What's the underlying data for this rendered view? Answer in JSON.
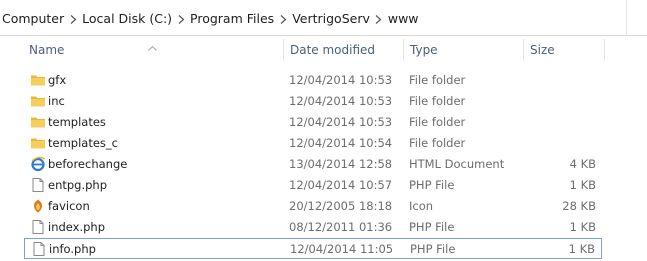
{
  "breadcrumb": [
    "Computer",
    "Local Disk (C:)",
    "Program Files",
    "VertrigoServ",
    "www"
  ],
  "columns": {
    "name": "Name",
    "date": "Date modified",
    "type": "Type",
    "size": "Size"
  },
  "colors": {
    "header_text": "#4c607a",
    "folder_yellow": "#f0c64a",
    "focus_border": "#7da2ce"
  },
  "rows": [
    {
      "icon": "folder-icon",
      "name": "gfx",
      "date": "12/04/2014 10:53",
      "type": "File folder",
      "size": ""
    },
    {
      "icon": "folder-icon",
      "name": "inc",
      "date": "12/04/2014 10:53",
      "type": "File folder",
      "size": ""
    },
    {
      "icon": "folder-icon",
      "name": "templates",
      "date": "12/04/2014 10:53",
      "type": "File folder",
      "size": ""
    },
    {
      "icon": "folder-icon",
      "name": "templates_c",
      "date": "12/04/2014 10:54",
      "type": "File folder",
      "size": ""
    },
    {
      "icon": "ie-html-icon",
      "name": "beforechange",
      "date": "13/04/2014 12:58",
      "type": "HTML Document",
      "size": "4 KB"
    },
    {
      "icon": "file-icon",
      "name": "entpg.php",
      "date": "12/04/2014 10:57",
      "type": "PHP File",
      "size": "1 KB"
    },
    {
      "icon": "favicon-icon",
      "name": "favicon",
      "date": "20/12/2005 18:18",
      "type": "Icon",
      "size": "28 KB"
    },
    {
      "icon": "file-icon",
      "name": "index.php",
      "date": "08/12/2011 01:36",
      "type": "PHP File",
      "size": "1 KB"
    },
    {
      "icon": "file-icon",
      "name": "info.php",
      "date": "12/04/2014 11:05",
      "type": "PHP File",
      "size": "1 KB",
      "focused": true
    }
  ]
}
